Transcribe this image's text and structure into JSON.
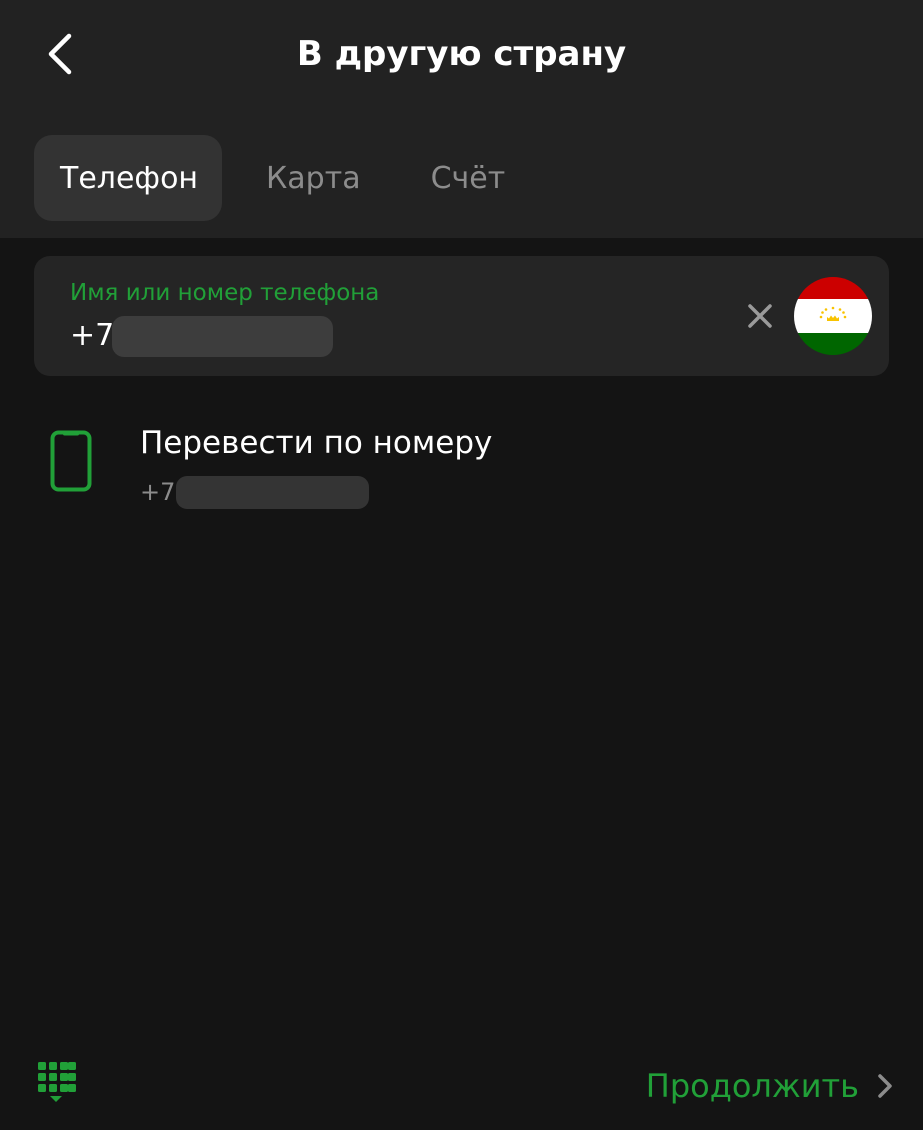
{
  "header": {
    "title": "В другую страну",
    "back_icon": "chevron-left-icon"
  },
  "tabs": [
    {
      "label": "Телефон",
      "active": true
    },
    {
      "label": "Карта",
      "active": false
    },
    {
      "label": "Счёт",
      "active": false
    }
  ],
  "recipient_input": {
    "label": "Имя или номер телефона",
    "prefix": "+7",
    "clear_icon": "close-icon",
    "country_flag": "tajikistan-flag-icon"
  },
  "suggestion": {
    "title": "Перевести по номеру",
    "prefix": "+7",
    "icon": "smartphone-icon"
  },
  "footer": {
    "keyboard_icon": "keypad-icon",
    "continue_label": "Продолжить",
    "continue_icon": "chevron-right-icon"
  },
  "colors": {
    "accent": "#21a038",
    "background": "#141414",
    "header_background": "#222222"
  }
}
